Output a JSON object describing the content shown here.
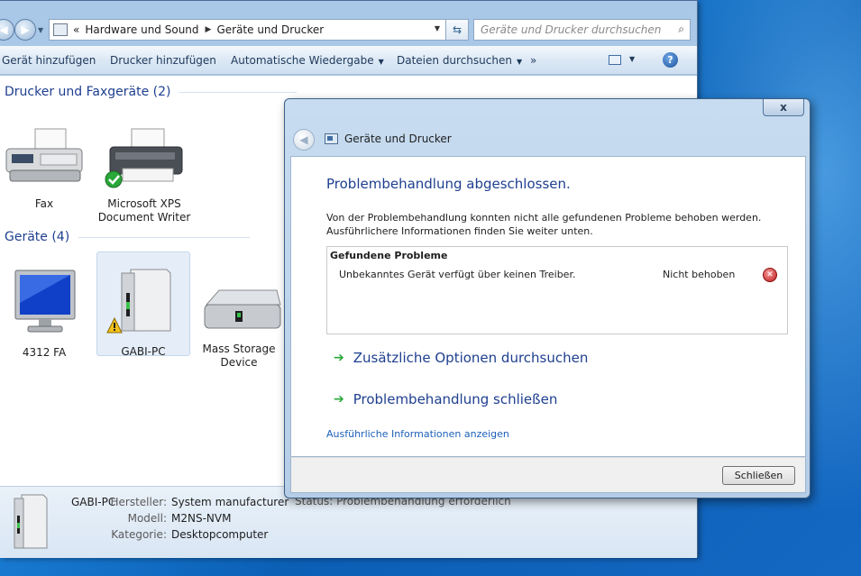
{
  "window": {
    "breadcrumb": {
      "prefix": "«",
      "seg1": "Hardware und Sound",
      "seg2": "Geräte und Drucker"
    },
    "search_placeholder": "Geräte und Drucker durchsuchen"
  },
  "toolbar": {
    "add_device": "Gerät hinzufügen",
    "add_printer": "Drucker hinzufügen",
    "autoplay": "Automatische Wiedergabe",
    "browse_files": "Dateien durchsuchen",
    "more": "»"
  },
  "groups": {
    "printers": {
      "title": "Drucker und Faxgeräte (2)",
      "items": [
        {
          "label": "Fax"
        },
        {
          "label": "Microsoft XPS Document Writer"
        }
      ]
    },
    "devices": {
      "title": "Geräte (4)",
      "items": [
        {
          "label": "4312 FA"
        },
        {
          "label": "GABI-PC"
        },
        {
          "label": "Mass Storage Device"
        }
      ]
    }
  },
  "details": {
    "name": "GABI-PC",
    "manufacturer_label": "Hersteller:",
    "manufacturer": "System manufacturer",
    "model_label": "Modell:",
    "model": "M2NS-NVM",
    "category_label": "Kategorie:",
    "category": "Desktopcomputer",
    "status_partial": "Status:  Problembehandlung erforderlich"
  },
  "dialog": {
    "close_glyph": "x",
    "title": "Geräte und Drucker",
    "heading": "Problembehandlung abgeschlossen.",
    "description": "Von der Problembehandlung konnten nicht alle gefundenen Probleme behoben werden. Ausführlichere Informationen finden Sie weiter unten.",
    "problems_header": "Gefundene Probleme",
    "problems": [
      {
        "text": "Unbekanntes Gerät verfügt über keinen Treiber.",
        "status": "Nicht behoben"
      }
    ],
    "option1": "Zusätzliche Optionen durchsuchen",
    "option2": "Problembehandlung schließen",
    "details_link": "Ausführliche Informationen anzeigen",
    "close_button": "Schließen"
  },
  "colors": {
    "heading_blue": "#1e3f8f",
    "link_blue": "#1c5fb8",
    "arrow_green": "#2aa83a",
    "error_red": "#c01818"
  }
}
